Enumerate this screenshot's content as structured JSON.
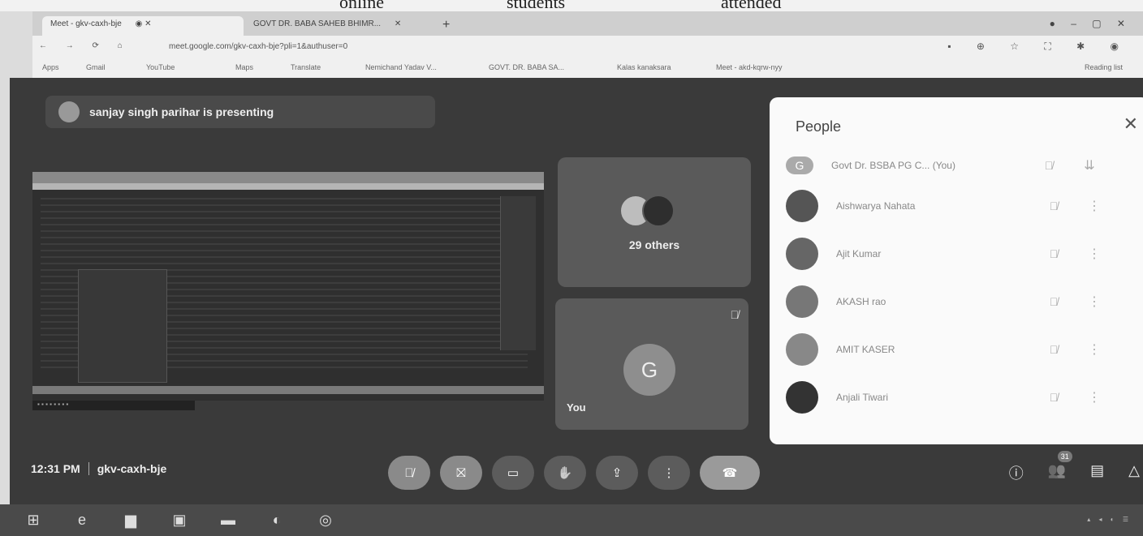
{
  "overlay_text": [
    "online",
    "students",
    "attended"
  ],
  "browser": {
    "tabs": [
      {
        "label": "Meet - gkv-caxh-bje",
        "active": true
      },
      {
        "label": "GOVT DR. BABA SAHEB BHIMR...",
        "active": false
      }
    ],
    "url": "meet.google.com/gkv-caxh-bje?pli=1&authuser=0",
    "bookmarks": [
      "Apps",
      "Gmail",
      "YouTube",
      "Maps",
      "Translate",
      "Nemichand Yadav V...",
      "GOVT. DR. BABA SA...",
      "Kalas kanaksara",
      "Meet - akd-kqrw-nyy",
      "Reading list"
    ]
  },
  "meet": {
    "presenting_text": "sanjay singh parihar is presenting",
    "others_label": "29 others",
    "you_initial": "G",
    "you_label": "You",
    "time": "12:31 PM",
    "meeting_code": "gkv-caxh-bje",
    "participant_badge": "31",
    "people_panel": {
      "title": "People",
      "participants": [
        {
          "name": "Govt Dr. BSBA PG C... (You)",
          "initial": "G"
        },
        {
          "name": "Aishwarya Nahata",
          "initial": ""
        },
        {
          "name": "Ajit Kumar",
          "initial": ""
        },
        {
          "name": "AKASH rao",
          "initial": ""
        },
        {
          "name": "AMIT KASER",
          "initial": ""
        },
        {
          "name": "Anjali Tiwari",
          "initial": ""
        }
      ]
    }
  },
  "icons": {
    "mic_off": "mic-off-icon",
    "cam_off": "camera-off-icon",
    "captions": "captions-icon",
    "hand": "hand-icon",
    "present": "present-icon",
    "more": "more-icon",
    "end": "end-call-icon"
  }
}
